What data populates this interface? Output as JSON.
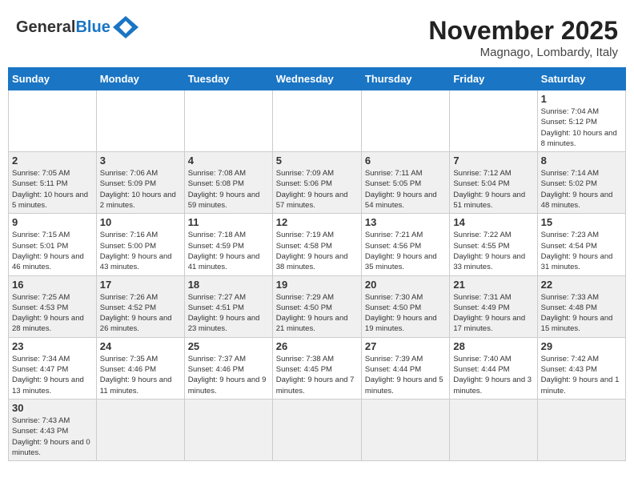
{
  "header": {
    "logo_general": "General",
    "logo_blue": "Blue",
    "month_title": "November 2025",
    "location": "Magnago, Lombardy, Italy"
  },
  "weekdays": [
    "Sunday",
    "Monday",
    "Tuesday",
    "Wednesday",
    "Thursday",
    "Friday",
    "Saturday"
  ],
  "weeks": [
    {
      "days": [
        {
          "date": "",
          "info": ""
        },
        {
          "date": "",
          "info": ""
        },
        {
          "date": "",
          "info": ""
        },
        {
          "date": "",
          "info": ""
        },
        {
          "date": "",
          "info": ""
        },
        {
          "date": "",
          "info": ""
        },
        {
          "date": "1",
          "info": "Sunrise: 7:04 AM\nSunset: 5:12 PM\nDaylight: 10 hours and 8 minutes."
        }
      ]
    },
    {
      "days": [
        {
          "date": "2",
          "info": "Sunrise: 7:05 AM\nSunset: 5:11 PM\nDaylight: 10 hours and 5 minutes."
        },
        {
          "date": "3",
          "info": "Sunrise: 7:06 AM\nSunset: 5:09 PM\nDaylight: 10 hours and 2 minutes."
        },
        {
          "date": "4",
          "info": "Sunrise: 7:08 AM\nSunset: 5:08 PM\nDaylight: 9 hours and 59 minutes."
        },
        {
          "date": "5",
          "info": "Sunrise: 7:09 AM\nSunset: 5:06 PM\nDaylight: 9 hours and 57 minutes."
        },
        {
          "date": "6",
          "info": "Sunrise: 7:11 AM\nSunset: 5:05 PM\nDaylight: 9 hours and 54 minutes."
        },
        {
          "date": "7",
          "info": "Sunrise: 7:12 AM\nSunset: 5:04 PM\nDaylight: 9 hours and 51 minutes."
        },
        {
          "date": "8",
          "info": "Sunrise: 7:14 AM\nSunset: 5:02 PM\nDaylight: 9 hours and 48 minutes."
        }
      ]
    },
    {
      "days": [
        {
          "date": "9",
          "info": "Sunrise: 7:15 AM\nSunset: 5:01 PM\nDaylight: 9 hours and 46 minutes."
        },
        {
          "date": "10",
          "info": "Sunrise: 7:16 AM\nSunset: 5:00 PM\nDaylight: 9 hours and 43 minutes."
        },
        {
          "date": "11",
          "info": "Sunrise: 7:18 AM\nSunset: 4:59 PM\nDaylight: 9 hours and 41 minutes."
        },
        {
          "date": "12",
          "info": "Sunrise: 7:19 AM\nSunset: 4:58 PM\nDaylight: 9 hours and 38 minutes."
        },
        {
          "date": "13",
          "info": "Sunrise: 7:21 AM\nSunset: 4:56 PM\nDaylight: 9 hours and 35 minutes."
        },
        {
          "date": "14",
          "info": "Sunrise: 7:22 AM\nSunset: 4:55 PM\nDaylight: 9 hours and 33 minutes."
        },
        {
          "date": "15",
          "info": "Sunrise: 7:23 AM\nSunset: 4:54 PM\nDaylight: 9 hours and 31 minutes."
        }
      ]
    },
    {
      "days": [
        {
          "date": "16",
          "info": "Sunrise: 7:25 AM\nSunset: 4:53 PM\nDaylight: 9 hours and 28 minutes."
        },
        {
          "date": "17",
          "info": "Sunrise: 7:26 AM\nSunset: 4:52 PM\nDaylight: 9 hours and 26 minutes."
        },
        {
          "date": "18",
          "info": "Sunrise: 7:27 AM\nSunset: 4:51 PM\nDaylight: 9 hours and 23 minutes."
        },
        {
          "date": "19",
          "info": "Sunrise: 7:29 AM\nSunset: 4:50 PM\nDaylight: 9 hours and 21 minutes."
        },
        {
          "date": "20",
          "info": "Sunrise: 7:30 AM\nSunset: 4:50 PM\nDaylight: 9 hours and 19 minutes."
        },
        {
          "date": "21",
          "info": "Sunrise: 7:31 AM\nSunset: 4:49 PM\nDaylight: 9 hours and 17 minutes."
        },
        {
          "date": "22",
          "info": "Sunrise: 7:33 AM\nSunset: 4:48 PM\nDaylight: 9 hours and 15 minutes."
        }
      ]
    },
    {
      "days": [
        {
          "date": "23",
          "info": "Sunrise: 7:34 AM\nSunset: 4:47 PM\nDaylight: 9 hours and 13 minutes."
        },
        {
          "date": "24",
          "info": "Sunrise: 7:35 AM\nSunset: 4:46 PM\nDaylight: 9 hours and 11 minutes."
        },
        {
          "date": "25",
          "info": "Sunrise: 7:37 AM\nSunset: 4:46 PM\nDaylight: 9 hours and 9 minutes."
        },
        {
          "date": "26",
          "info": "Sunrise: 7:38 AM\nSunset: 4:45 PM\nDaylight: 9 hours and 7 minutes."
        },
        {
          "date": "27",
          "info": "Sunrise: 7:39 AM\nSunset: 4:44 PM\nDaylight: 9 hours and 5 minutes."
        },
        {
          "date": "28",
          "info": "Sunrise: 7:40 AM\nSunset: 4:44 PM\nDaylight: 9 hours and 3 minutes."
        },
        {
          "date": "29",
          "info": "Sunrise: 7:42 AM\nSunset: 4:43 PM\nDaylight: 9 hours and 1 minute."
        }
      ]
    },
    {
      "days": [
        {
          "date": "30",
          "info": "Sunrise: 7:43 AM\nSunset: 4:43 PM\nDaylight: 9 hours and 0 minutes."
        },
        {
          "date": "",
          "info": ""
        },
        {
          "date": "",
          "info": ""
        },
        {
          "date": "",
          "info": ""
        },
        {
          "date": "",
          "info": ""
        },
        {
          "date": "",
          "info": ""
        },
        {
          "date": "",
          "info": ""
        }
      ]
    }
  ]
}
